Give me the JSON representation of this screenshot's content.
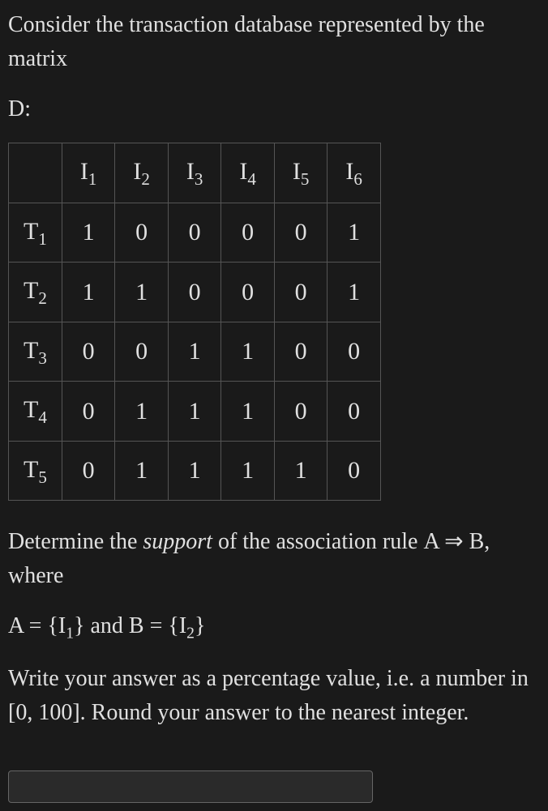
{
  "intro_text_1": "Consider the transaction database represented by the matrix",
  "db_label": "D:",
  "table": {
    "col_headers": [
      "I",
      "I",
      "I",
      "I",
      "I",
      "I"
    ],
    "col_subs": [
      "1",
      "2",
      "3",
      "4",
      "5",
      "6"
    ],
    "rows": [
      {
        "label": "T",
        "sub": "1",
        "values": [
          "1",
          "0",
          "0",
          "0",
          "0",
          "1"
        ]
      },
      {
        "label": "T",
        "sub": "2",
        "values": [
          "1",
          "1",
          "0",
          "0",
          "0",
          "1"
        ]
      },
      {
        "label": "T",
        "sub": "3",
        "values": [
          "0",
          "0",
          "1",
          "1",
          "0",
          "0"
        ]
      },
      {
        "label": "T",
        "sub": "4",
        "values": [
          "0",
          "1",
          "1",
          "1",
          "0",
          "0"
        ]
      },
      {
        "label": "T",
        "sub": "5",
        "values": [
          "0",
          "1",
          "1",
          "1",
          "1",
          "0"
        ]
      }
    ]
  },
  "question_1_prefix": "Determine the ",
  "question_1_italic": "support",
  "question_1_suffix": " of the association rule ",
  "rule_A": "A",
  "rule_implies": " ⇒ ",
  "rule_B": "B",
  "rule_where": ", where",
  "defs_prefix": "A = {",
  "defs_I1_label": "I",
  "defs_I1_sub": "1",
  "defs_mid": "} and B = {",
  "defs_I2_label": "I",
  "defs_I2_sub": "2",
  "defs_suffix": "}",
  "instruction": "Write your answer as a percentage value, i.e. a number in [0, 100]. Round your answer to the nearest integer.",
  "answer_value": ""
}
